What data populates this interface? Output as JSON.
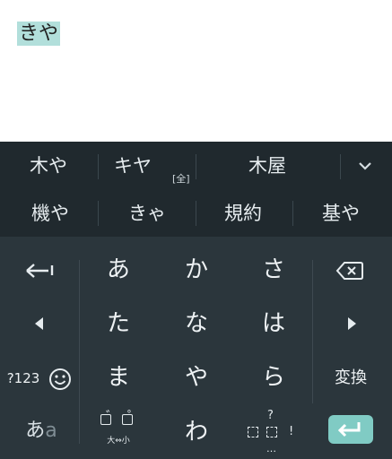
{
  "editor": {
    "composing_text": "きや"
  },
  "candidates": {
    "row1": [
      "木や",
      "キヤ",
      "木屋"
    ],
    "row1_sub": "[全]",
    "row2": [
      "機や",
      "きゃ",
      "規約",
      "基や"
    ]
  },
  "keyboard": {
    "kana_row1": [
      "あ",
      "か",
      "さ"
    ],
    "kana_row2": [
      "た",
      "な",
      "は"
    ],
    "kana_row3": [
      "ま",
      "や",
      "ら"
    ],
    "kana_row4_center": "わ",
    "symbols_label": "?123",
    "convert_label": "変換",
    "mode_label_hira": "あ",
    "mode_label_alpha": "a",
    "modifier_label": "大⇔小",
    "punct_top": "?",
    "punct_dots": "…",
    "punct_excl": "!",
    "dakuten": "゛",
    "handakuten": "゜"
  },
  "colors": {
    "candidate_bg": "#20292e",
    "keyboard_bg": "#2b363c",
    "enter_accent": "#80cbc4",
    "composing_highlight": "#b2dfdb"
  }
}
